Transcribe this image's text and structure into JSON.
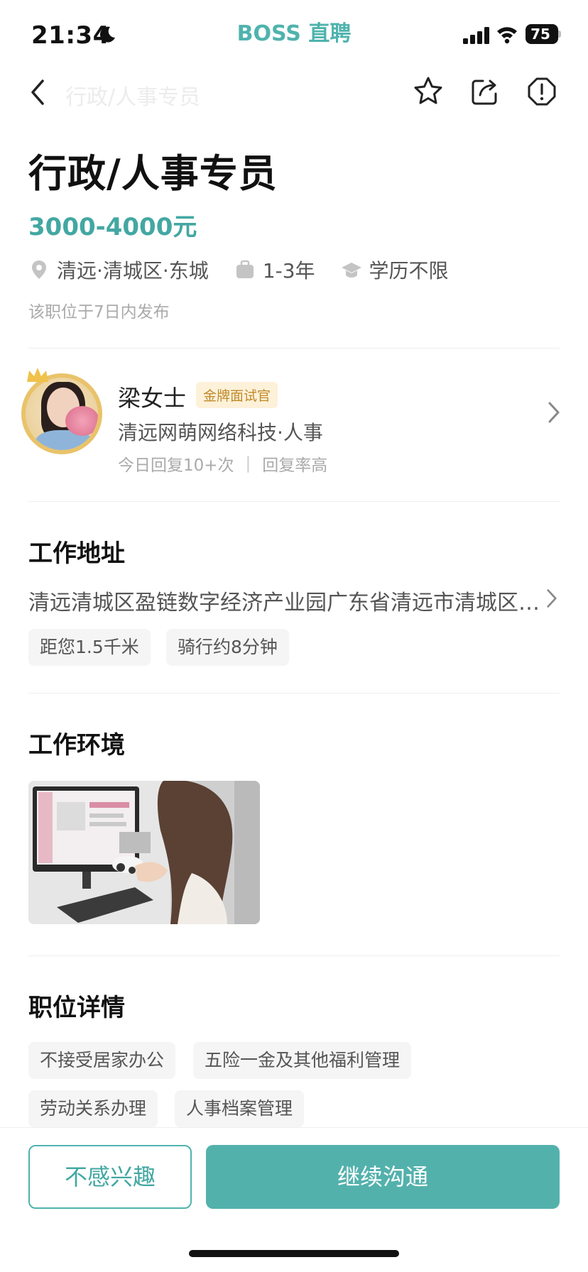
{
  "status_bar": {
    "time": "21:34",
    "app_brand": "BOSS 直聘",
    "battery_level": "75"
  },
  "nav": {
    "title": "行政/人事专员"
  },
  "job": {
    "title": "行政/人事专员",
    "salary": "3000-4000元",
    "location": "清远·清城区·东城",
    "experience": "1-3年",
    "education": "学历不限",
    "post_time": "该职位于7日内发布"
  },
  "recruiter": {
    "name": "梁女士",
    "badge": "金牌面试官",
    "company": "清远网萌网络科技·人事",
    "reply_count": "今日回复10+次",
    "reply_rate": "回复率高"
  },
  "address": {
    "section_title": "工作地址",
    "text": "清远清城区盈链数字经济产业园广东省清远市清城区东城街道",
    "tags": [
      "距您1.5千米",
      "骑行约8分钟"
    ]
  },
  "environment": {
    "section_title": "工作环境"
  },
  "details": {
    "section_title": "职位详情",
    "tags": [
      "不接受居家办公",
      "五险一金及其他福利管理",
      "劳动关系办理",
      "人事档案管理"
    ]
  },
  "actions": {
    "not_interested": "不感兴趣",
    "continue_chat": "继续沟通"
  },
  "colors": {
    "brand": "#4fb3ad",
    "salary": "#43a7a2",
    "primary_button": "#53b1ac",
    "gold_badge_text": "#c08a2a",
    "gold_badge_bg": "#fdf1d9"
  }
}
